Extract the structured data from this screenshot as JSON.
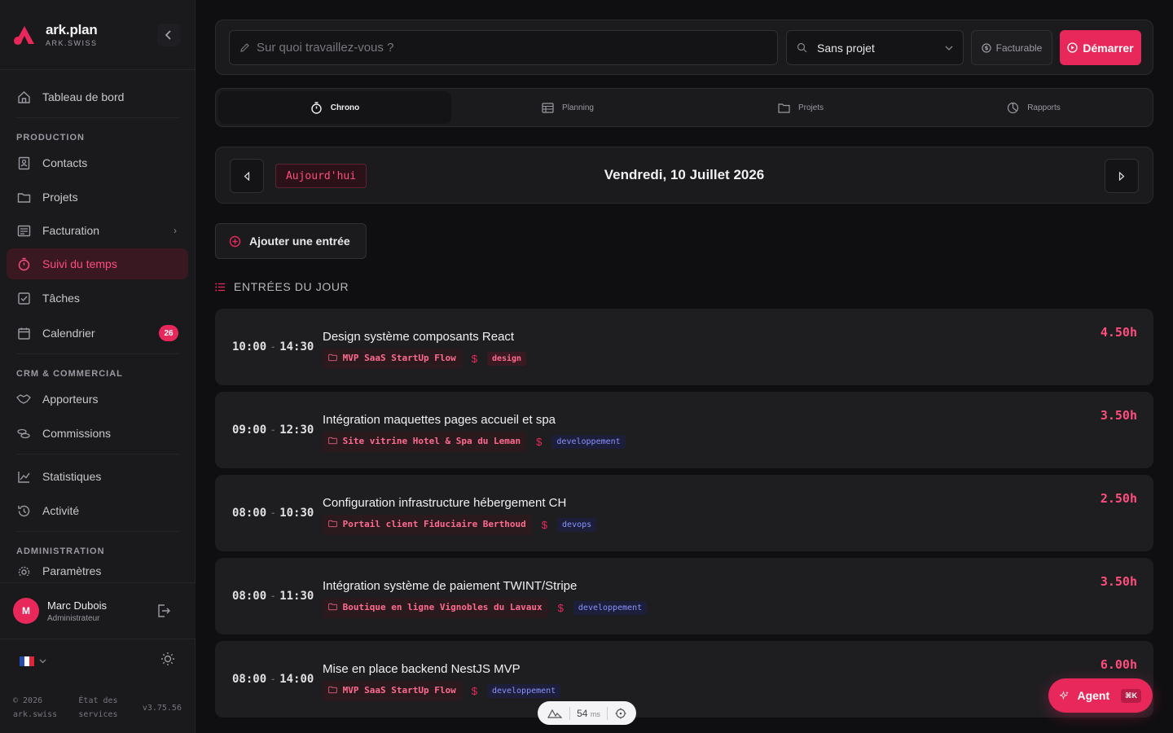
{
  "brand": {
    "name": "ark.plan",
    "sub": "ARK.SWISS"
  },
  "nav": {
    "dashboard": "Tableau de bord",
    "section_production": "PRODUCTION",
    "contacts": "Contacts",
    "projects": "Projets",
    "billing": "Facturation",
    "time_tracking": "Suivi du temps",
    "tasks": "Tâches",
    "calendar": "Calendrier",
    "calendar_badge": "26",
    "section_crm": "CRM & COMMERCIAL",
    "referrers": "Apporteurs",
    "commissions": "Commissions",
    "statistics": "Statistiques",
    "activity": "Activité",
    "section_admin": "ADMINISTRATION",
    "settings": "Paramètres"
  },
  "user": {
    "initial": "M",
    "name": "Marc Dubois",
    "role": "Administrateur"
  },
  "footer": {
    "copyright": "© 2026 ark.swiss",
    "status": "État des services",
    "version": "v3.75.56"
  },
  "topbar": {
    "task_placeholder": "Sur quoi travaillez-vous ?",
    "project_value": "Sans projet",
    "billable_label": "Facturable",
    "start_label": "Démarrer"
  },
  "tabs": [
    {
      "label": "Chrono"
    },
    {
      "label": "Planning"
    },
    {
      "label": "Projets"
    },
    {
      "label": "Rapports"
    }
  ],
  "date": {
    "today_label": "Aujourd'hui",
    "title": "Vendredi, 10 Juillet 2026"
  },
  "add_entry_label": "Ajouter une entrée",
  "entries_title": "ENTRÉES DU JOUR",
  "entries": [
    {
      "start": "10:00",
      "end": "14:30",
      "title": "Design système composants React",
      "project": "MVP SaaS StartUp Flow",
      "tag": "design",
      "duration": "4.50h"
    },
    {
      "start": "09:00",
      "end": "12:30",
      "title": "Intégration maquettes pages accueil et spa",
      "project": "Site vitrine Hotel & Spa du Leman",
      "tag": "developpement",
      "duration": "3.50h"
    },
    {
      "start": "08:00",
      "end": "10:30",
      "title": "Configuration infrastructure hébergement CH",
      "project": "Portail client Fiduciaire Berthoud",
      "tag": "devops",
      "duration": "2.50h"
    },
    {
      "start": "08:00",
      "end": "11:30",
      "title": "Intégration système de paiement TWINT/Stripe",
      "project": "Boutique en ligne Vignobles du Lavaux",
      "tag": "developpement",
      "duration": "3.50h"
    },
    {
      "start": "08:00",
      "end": "14:00",
      "title": "Mise en place backend NestJS MVP",
      "project": "MVP SaaS StartUp Flow",
      "tag": "developpement",
      "duration": "6.00h"
    }
  ],
  "agent": {
    "label": "Agent",
    "shortcut": "⌘K"
  },
  "perf": {
    "value": "54",
    "unit": "ms"
  },
  "colors": {
    "accent": "#e8285a",
    "accent_text": "#ff4d7d",
    "background": "#0f0f11",
    "sidebar": "#1a1a1d"
  }
}
